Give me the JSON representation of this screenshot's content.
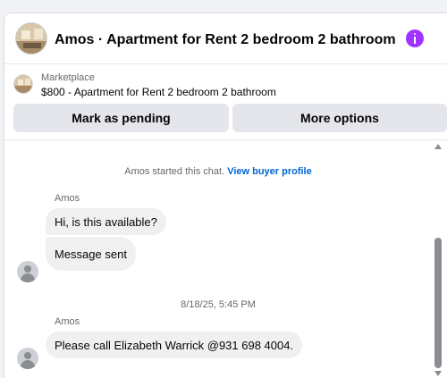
{
  "header": {
    "title": "Amos · Apartment for Rent 2 bedroom 2 bathroom",
    "avatar_icon": "listing-photo",
    "info_icon": "info-icon",
    "info_color": "#a033ff"
  },
  "listing": {
    "label": "Marketplace",
    "title": "$800 - Apartment for Rent 2 bedroom 2 bathroom",
    "buttons": {
      "pending": "Mark as pending",
      "more": "More options"
    }
  },
  "chat": {
    "started_text": "Amos started this chat.",
    "view_profile_link": "View buyer profile",
    "groups": [
      {
        "sender": "Amos",
        "messages": [
          "Hi, is this available?",
          "Message sent"
        ]
      },
      {
        "sender": "Amos",
        "messages": [
          "Please call Elizabeth Warrick @931 698 4004."
        ]
      }
    ],
    "timestamp": "8/18/25, 5:45 PM"
  },
  "colors": {
    "link": "#0064d1",
    "bubble": "#f0f0f0",
    "button": "#e4e6eb"
  }
}
